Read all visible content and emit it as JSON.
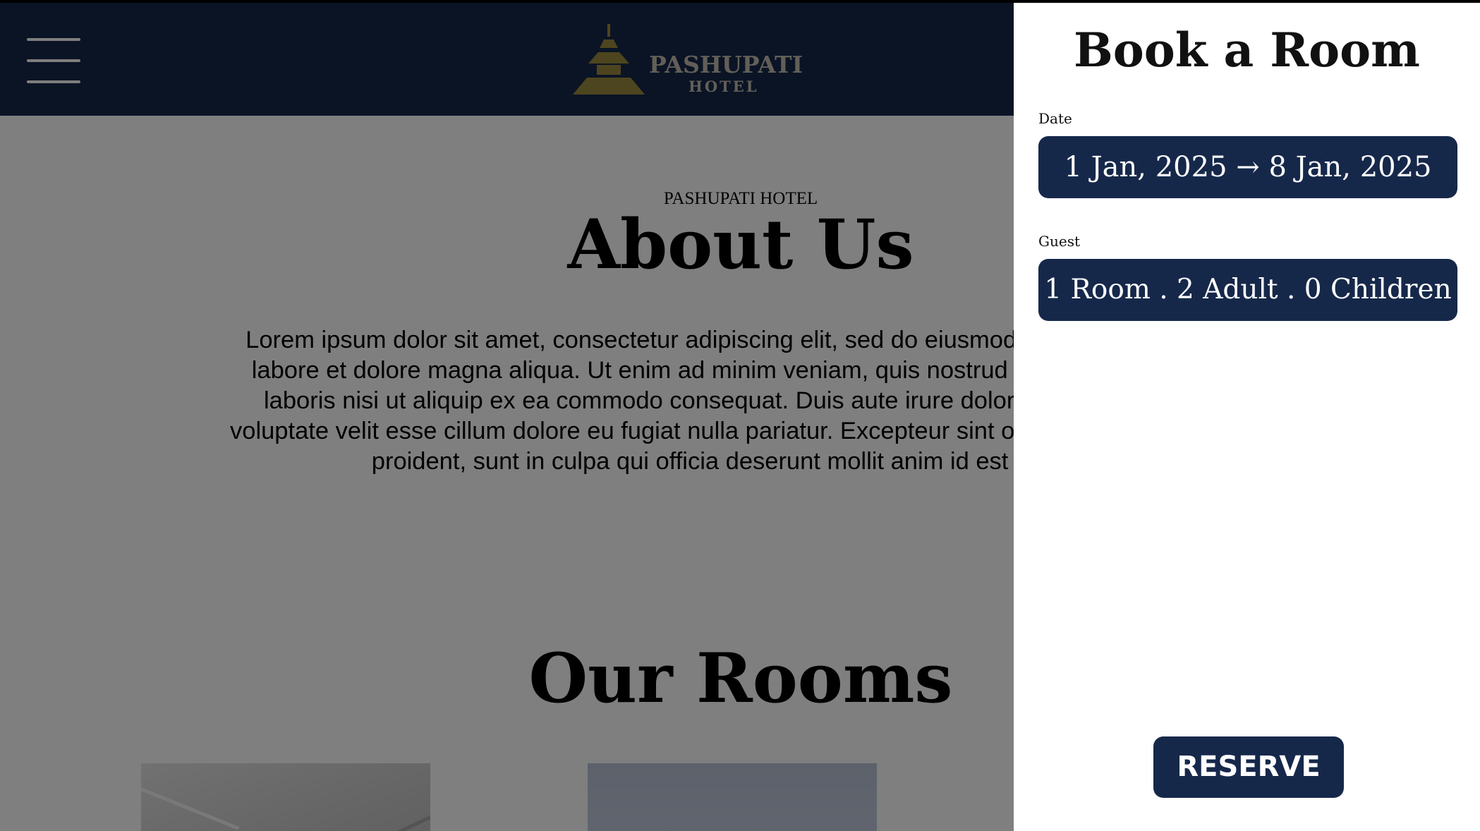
{
  "header": {
    "logo": {
      "name": "PASHUPATI",
      "subtitle": "HOTEL"
    },
    "menu_icon": "hamburger-menu-icon"
  },
  "about": {
    "eyebrow": "PASHUPATI HOTEL",
    "title": "About Us",
    "body": "Lorem ipsum dolor sit amet, consectetur adipiscing elit, sed do eiusmod tempor incididunt ut labore et dolore magna aliqua. Ut enim ad minim veniam, quis nostrud exercitation ullamco laboris nisi ut aliquip ex ea commodo consequat. Duis aute irure dolor in reprehenderit in voluptate velit esse cillum dolore eu fugiat nulla pariatur. Excepteur sint occaecat cupidatat non proident, sunt in culpa qui officia deserunt mollit anim id est laborum."
  },
  "rooms": {
    "title": "Our Rooms"
  },
  "booking": {
    "title": "Book a Room",
    "date_label": "Date",
    "date_value": "1 Jan, 2025 → 8 Jan, 2025",
    "guest_label": "Guest",
    "guest_value": "1 Room . 2 Adult . 0 Children",
    "reserve_label": "RESERVE"
  },
  "colors": {
    "navy": "#16284a",
    "logo_gold": "#9a8a3e",
    "logo_text": "#c5bfb1"
  }
}
